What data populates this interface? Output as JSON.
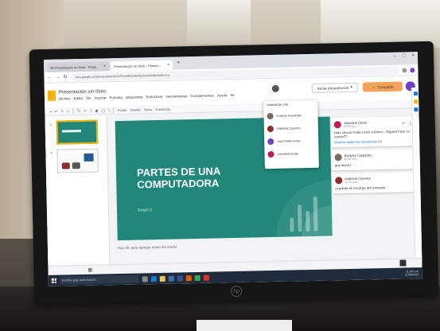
{
  "browser": {
    "tabs": [
      {
        "label": "Mi Presentación en línea - Prese..."
      },
      {
        "label": "Presentación sin título - Presen..."
      }
    ],
    "url": "docs.google.com/presentation/d/1d7Rm9tSfJyWmBQ42cW/edit#slide=id.p"
  },
  "slides": {
    "doc_title": "Presentación sin título",
    "menus": [
      "Archivo",
      "Editar",
      "Ver",
      "Insertar",
      "Formato",
      "Diapositiva",
      "Estructurar",
      "Herramientas",
      "Complementos",
      "Ayuda",
      "Se"
    ],
    "present_label": "Iniciar presentación",
    "share_label": "Compartir",
    "toolbar": [
      "Fondo",
      "Diseño",
      "Tema",
      "Transición"
    ],
    "thumbnails": [
      "1",
      "2"
    ],
    "notes_placeholder": "Haz clic para agregar notas del orador"
  },
  "slide": {
    "title": "PARTES DE UNA COMPUTADORA",
    "subtitle": "Grupo 2"
  },
  "history_dropdown": {
    "heading": "Historial de chat",
    "users": [
      {
        "name": "Evelyny Cespedes",
        "color": "#7a6a5a"
      },
      {
        "name": "Gabriela Caceres",
        "color": "#8c2f2f"
      },
      {
        "name": "Juan Pablo Arnez",
        "color": "#6f42c1"
      },
      {
        "name": "Josseline duran",
        "color": "#c2185b"
      }
    ]
  },
  "comments": [
    {
      "name": "Josseline duran",
      "time": "11:29 a.m.",
      "text": "Hola chicos! Falta incluir a Arnez... Alguien hace su correo??",
      "link": "Mostrar todas las respuestas (2)",
      "color": "#c2185b"
    },
    {
      "name": "Evelyny Cespedes",
      "time": "11:30 a.m.",
      "text": "que dicen?",
      "link": "",
      "color": "#7a6a5a"
    },
    {
      "name": "Gabriela Caceres",
      "time": "11:31 a.m.",
      "text": "el puede se encarga del concepto",
      "link": "",
      "color": "#8c2f2f"
    }
  ],
  "taskbar": {
    "search_placeholder": "Escribe aquí para buscar",
    "time": "11:38 a.m.",
    "date": "21/09/2021"
  },
  "colors": {
    "slide_bg": "#20877a",
    "share": "#f4a259",
    "accent": "#1a73e8"
  }
}
